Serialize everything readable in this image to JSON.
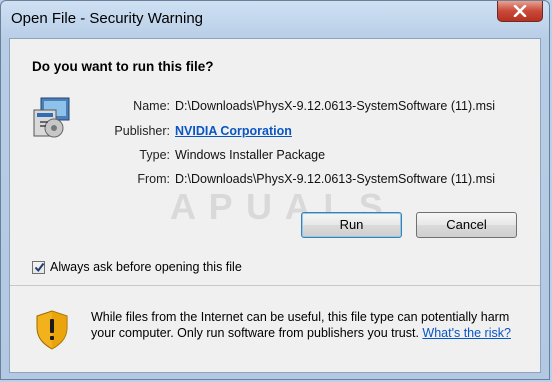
{
  "window": {
    "title": "Open File - Security Warning"
  },
  "dialog": {
    "heading": "Do you want to run this file?",
    "fields": [
      {
        "label": "Name:",
        "value": "D:\\Downloads\\PhysX-9.12.0613-SystemSoftware (11).msi"
      },
      {
        "label": "Publisher:",
        "value": "NVIDIA Corporation"
      },
      {
        "label": "Type:",
        "value": "Windows Installer Package"
      },
      {
        "label": "From:",
        "value": "D:\\Downloads\\PhysX-9.12.0613-SystemSoftware (11).msi"
      }
    ],
    "buttons": {
      "run": "Run",
      "cancel": "Cancel"
    },
    "checkbox": {
      "label": "Always ask before opening this file",
      "checked": true
    },
    "warning": {
      "text": "While files from the Internet can be useful, this file type can potentially harm your computer. Only run software from publishers you trust.",
      "link": "What's the risk?"
    }
  },
  "watermark": "A P U A L S",
  "icons": [
    "installer-icon",
    "close-icon",
    "check-icon",
    "shield-warning-icon"
  ]
}
